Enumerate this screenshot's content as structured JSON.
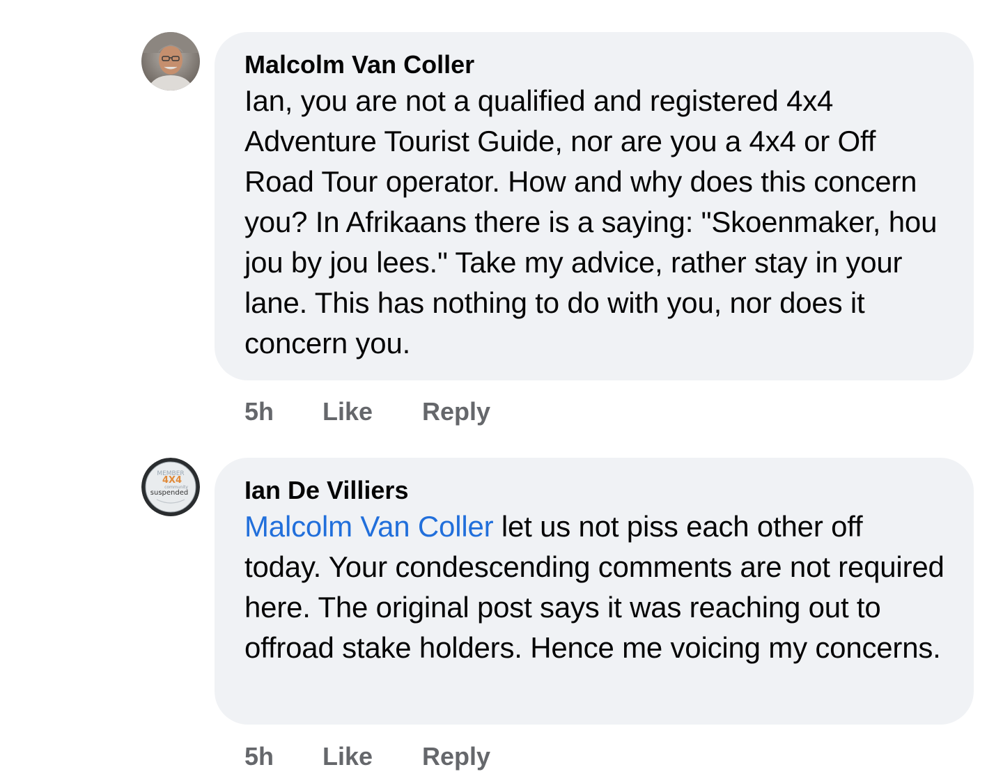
{
  "comments": [
    {
      "author": "Malcolm Van Coller",
      "mention": "",
      "text": "Ian, you are not a qualified and registered 4x4 Adventure Tourist Guide, nor are you a 4x4 or Off Road Tour operator. How and why does this concern you? In Afrikaans there is a saying: \"Skoenmaker, hou jou by jou lees.\" Take my advice, rather stay in your lane. This has nothing to do with you, nor does it concern you.",
      "time": "5h",
      "like_label": "Like",
      "reply_label": "Reply",
      "avatar_icon": "profile-photo-man"
    },
    {
      "author": "Ian De Villiers",
      "mention": "Malcolm Van Coller",
      "text": " let us not piss each other off today. Your condescending comments are not required here. The original post says it was reaching out to offroad stake holders. Hence me voicing my concerns.",
      "time": "5h",
      "like_label": "Like",
      "reply_label": "Reply",
      "avatar_icon": "profile-badge",
      "avatar_badge": {
        "top": "MEMBER",
        "middle": "4X4",
        "small": "community",
        "bottom": "suspended"
      }
    }
  ],
  "colors": {
    "bubble": "#f0f2f5",
    "mention": "#216fdb",
    "meta": "#65676b",
    "text": "#050505"
  }
}
